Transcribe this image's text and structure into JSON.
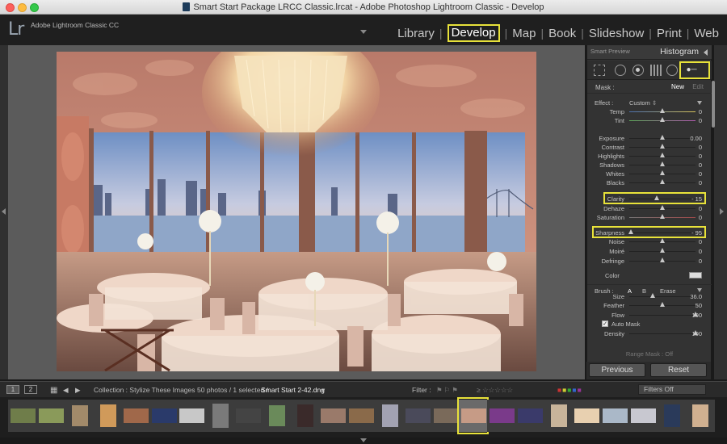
{
  "window": {
    "title": "Smart Start Package LRCC Classic.lrcat - Adobe Photoshop Lightroom Classic - Develop"
  },
  "app": {
    "logo": "Lr",
    "name": "Adobe Lightroom Classic CC"
  },
  "modules": {
    "items": [
      "Library",
      "Develop",
      "Map",
      "Book",
      "Slideshow",
      "Print",
      "Web"
    ],
    "active": "Develop",
    "separator": "|"
  },
  "panel": {
    "smart_preview": "Smart Preview",
    "histogram_title": "Histogram",
    "mask": {
      "label": "Mask :",
      "new": "New",
      "edit": "Edit"
    },
    "effect": {
      "label": "Effect :",
      "value": "Custom"
    },
    "sliders": [
      {
        "label": "Temp",
        "value": "0",
        "pos": 0.5
      },
      {
        "label": "Tint",
        "value": "0",
        "pos": 0.5
      },
      {
        "label": "Exposure",
        "value": "0.00",
        "pos": 0.5
      },
      {
        "label": "Contrast",
        "value": "0",
        "pos": 0.5
      },
      {
        "label": "Highlights",
        "value": "0",
        "pos": 0.5
      },
      {
        "label": "Shadows",
        "value": "0",
        "pos": 0.5
      },
      {
        "label": "Whites",
        "value": "0",
        "pos": 0.5
      },
      {
        "label": "Blacks",
        "value": "0",
        "pos": 0.5
      },
      {
        "label": "Clarity",
        "value": "- 15",
        "pos": 0.42
      },
      {
        "label": "Dehaze",
        "value": "0",
        "pos": 0.5
      },
      {
        "label": "Saturation",
        "value": "0",
        "pos": 0.5
      },
      {
        "label": "Sharpness",
        "value": "- 95",
        "pos": 0.03
      },
      {
        "label": "Noise",
        "value": "0",
        "pos": 0.5
      },
      {
        "label": "Moiré",
        "value": "0",
        "pos": 0.5
      },
      {
        "label": "Defringe",
        "value": "0",
        "pos": 0.5
      }
    ],
    "color_label": "Color",
    "brush": {
      "label": "Brush :",
      "a": "A",
      "b": "B",
      "erase": "Erase"
    },
    "brush_sliders": [
      {
        "label": "Size",
        "value": "36.0",
        "pos": 0.35
      },
      {
        "label": "Feather",
        "value": "50",
        "pos": 0.5
      },
      {
        "label": "Flow",
        "value": "100",
        "pos": 1.0
      },
      {
        "label": "Density",
        "value": "100",
        "pos": 1.0
      }
    ],
    "auto_mask": "Auto Mask",
    "range_mask": "Range Mask : Off",
    "previous": "Previous",
    "reset": "Reset"
  },
  "filmstrip_bar": {
    "page1": "1",
    "page2": "2",
    "collection": "Collection : Stylize These Images",
    "count": "50 photos / 1 selected /",
    "file": "Smart Start 2-42.dng",
    "filter": "Filter :",
    "filters_off": "Filters Off"
  }
}
